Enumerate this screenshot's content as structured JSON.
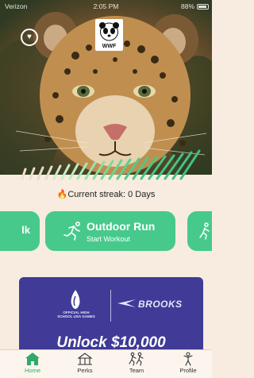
{
  "status_bar": {
    "carrier": "Verizon",
    "time": "2:05 PM",
    "battery": "88%"
  },
  "header": {
    "logo_text": "WWF"
  },
  "streak": {
    "label": "Current streak: 0 Days"
  },
  "workouts": {
    "left_partial": "lk",
    "main": {
      "title": "Outdoor Run",
      "subtitle": "Start Workout"
    }
  },
  "promo": {
    "partner_small": "OFFICIAL HIGH SCHOOL USA GAMES",
    "partner": "BROOKS",
    "headline": "Unlock $10,000"
  },
  "tabs": [
    {
      "label": "Home",
      "icon": "home-icon",
      "active": true
    },
    {
      "label": "Perks",
      "icon": "perks-icon",
      "active": false
    },
    {
      "label": "Team",
      "icon": "team-icon",
      "active": false
    },
    {
      "label": "Profile",
      "icon": "profile-icon",
      "active": false
    }
  ],
  "colors": {
    "accent": "#47c98c",
    "promo": "#3f3b96",
    "background": "#f7ecdf"
  }
}
